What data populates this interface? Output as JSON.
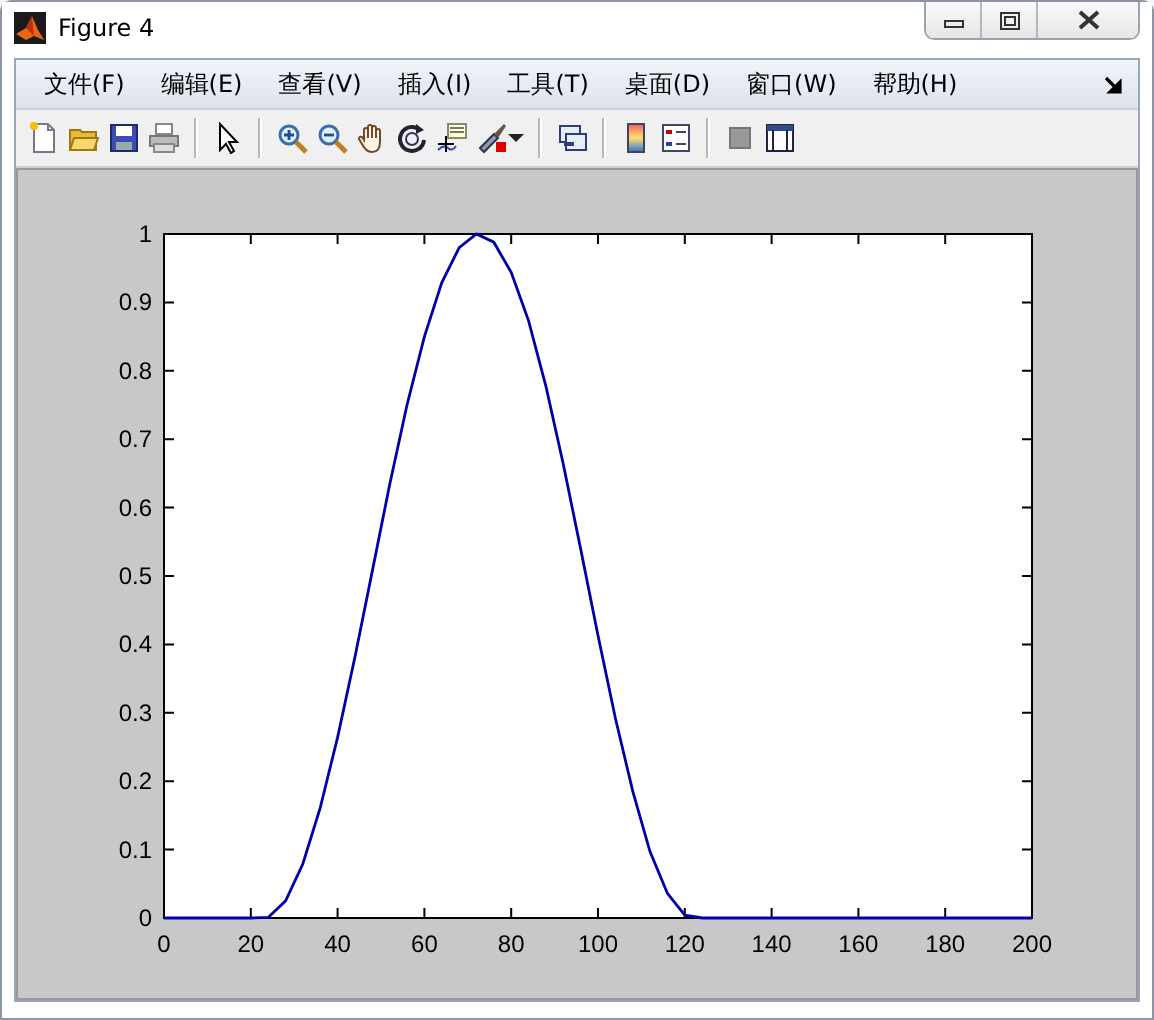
{
  "window": {
    "title": "Figure 4"
  },
  "menu": [
    "文件(F)",
    "编辑(E)",
    "查看(V)",
    "插入(I)",
    "工具(T)",
    "桌面(D)",
    "窗口(W)",
    "帮助(H)"
  ],
  "toolbar": [
    {
      "kind": "new"
    },
    {
      "kind": "open"
    },
    {
      "kind": "save"
    },
    {
      "kind": "print"
    },
    {
      "kind": "separator"
    },
    {
      "kind": "pointer"
    },
    {
      "kind": "separator"
    },
    {
      "kind": "zoom-in"
    },
    {
      "kind": "zoom-out"
    },
    {
      "kind": "pan"
    },
    {
      "kind": "rotate"
    },
    {
      "kind": "data-cursor"
    },
    {
      "kind": "brush"
    },
    {
      "kind": "dropdown"
    },
    {
      "kind": "separator"
    },
    {
      "kind": "link"
    },
    {
      "kind": "separator"
    },
    {
      "kind": "colorbar"
    },
    {
      "kind": "legend"
    },
    {
      "kind": "separator"
    },
    {
      "kind": "hide-tools"
    },
    {
      "kind": "show-tools"
    }
  ],
  "plot": {
    "chart_data": {
      "type": "line",
      "xlim": [
        0,
        200
      ],
      "ylim": [
        0,
        1
      ],
      "xticks": [
        0,
        20,
        40,
        60,
        80,
        100,
        120,
        140,
        160,
        180,
        200
      ],
      "yticks": [
        {
          "value": 0,
          "label": "0"
        },
        {
          "value": 0.1,
          "label": "0.1"
        },
        {
          "value": 0.2,
          "label": "0.2"
        },
        {
          "value": 0.3,
          "label": "0.3"
        },
        {
          "value": 0.4,
          "label": "0.4"
        },
        {
          "value": 0.5,
          "label": "0.5"
        },
        {
          "value": 0.6,
          "label": "0.6"
        },
        {
          "value": 0.7,
          "label": "0.7"
        },
        {
          "value": 0.8,
          "label": "0.8"
        },
        {
          "value": 0.9,
          "label": "0.9"
        },
        {
          "value": 1,
          "label": "1"
        }
      ],
      "x": [
        0,
        4,
        8,
        12,
        16,
        20,
        24,
        28,
        32,
        36,
        40,
        44,
        48,
        52,
        56,
        60,
        64,
        68,
        72,
        76,
        80,
        84,
        88,
        92,
        96,
        100,
        104,
        108,
        112,
        116,
        120,
        124,
        128,
        132,
        136,
        140,
        144,
        148,
        152,
        156,
        160,
        164,
        168,
        172,
        176,
        180,
        184,
        188,
        192,
        196,
        200
      ],
      "series": [
        {
          "color": "#0000aa",
          "values": [
            0,
            0,
            0,
            0,
            0,
            0,
            0.001,
            0.025,
            0.079,
            0.161,
            0.264,
            0.382,
            0.508,
            0.633,
            0.75,
            0.85,
            0.929,
            0.98,
            1.0,
            0.988,
            0.944,
            0.873,
            0.777,
            0.664,
            0.54,
            0.413,
            0.292,
            0.185,
            0.097,
            0.036,
            0.004,
            0,
            0,
            0,
            0,
            0,
            0,
            0,
            0,
            0,
            0,
            0,
            0,
            0,
            0,
            0,
            0,
            0,
            0,
            0,
            0
          ]
        }
      ]
    }
  }
}
